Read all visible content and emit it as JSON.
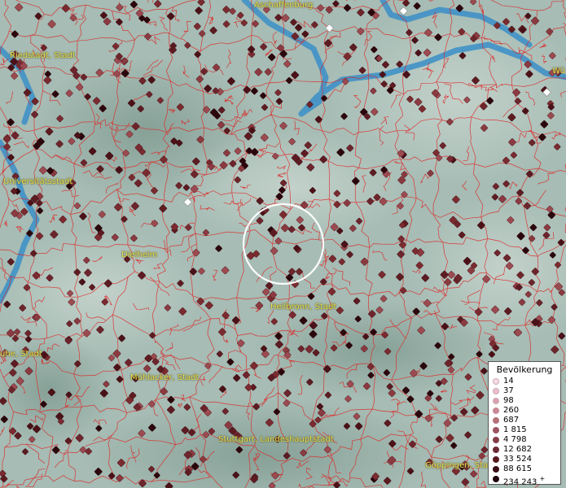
{
  "map": {
    "cities": [
      {
        "name": "Aschaffenburg"
      },
      {
        "name": "Riedstadt, Stadt"
      },
      {
        "name": "Universitätsstadt"
      },
      {
        "name": "Dielheim"
      },
      {
        "name": "Heilbronn, Stadt"
      },
      {
        "name": "uhe, Stadt"
      },
      {
        "name": "Mühlacker, Stadt"
      },
      {
        "name": "Stuttgart, Landeshauptstadt"
      },
      {
        "name": "Göppingen, Stad"
      },
      {
        "name": "Wü"
      }
    ],
    "colors": {
      "boundary": "#e02020",
      "water": "#3a8fc8",
      "marker": "#7a2b30",
      "selection_ring": "#ffffff"
    }
  },
  "legend": {
    "title": "Bevölkerung",
    "items": [
      {
        "label": "14",
        "color": "#f7dce3"
      },
      {
        "label": "37",
        "color": "#ecc0cb"
      },
      {
        "label": "98",
        "color": "#d9a2ae"
      },
      {
        "label": "260",
        "color": "#c98894"
      },
      {
        "label": "687",
        "color": "#b4707b"
      },
      {
        "label": "1 815",
        "color": "#9b5560"
      },
      {
        "label": "4 798",
        "color": "#843d48"
      },
      {
        "label": "12 682",
        "color": "#6d2a34"
      },
      {
        "label": "33 524",
        "color": "#561a23"
      },
      {
        "label": "88 615",
        "color": "#3a0d14"
      },
      {
        "label": "234 243",
        "color": "#1f0509",
        "suffix": "+"
      }
    ]
  }
}
